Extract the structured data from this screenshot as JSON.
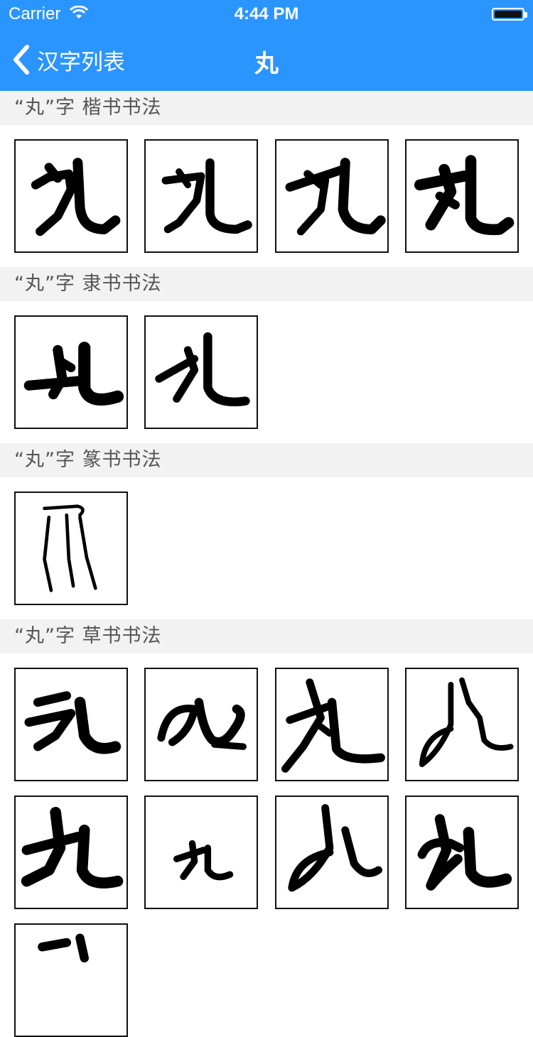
{
  "status_bar": {
    "carrier": "Carrier",
    "time": "4:44 PM"
  },
  "nav": {
    "back_label": "汉字列表",
    "title": "丸"
  },
  "sections": [
    {
      "title": "“丸”字  楷书书法",
      "style": "kaishu",
      "items": [
        "kai-1",
        "kai-2",
        "kai-3",
        "kai-4"
      ]
    },
    {
      "title": "“丸”字  隶书书法",
      "style": "lishu",
      "items": [
        "li-1",
        "li-2"
      ]
    },
    {
      "title": "“丸”字  篆书书法",
      "style": "zhuanshu",
      "items": [
        "zhuan-1"
      ]
    },
    {
      "title": "“丸”字  草书书法",
      "style": "caoshu",
      "items": [
        "cao-1",
        "cao-2",
        "cao-3",
        "cao-4",
        "cao-5",
        "cao-6",
        "cao-7",
        "cao-8",
        "cao-9"
      ]
    }
  ],
  "colors": {
    "nav_bar": "#2b95ff",
    "section_bg": "#f2f2f2",
    "ink": "#000000"
  }
}
